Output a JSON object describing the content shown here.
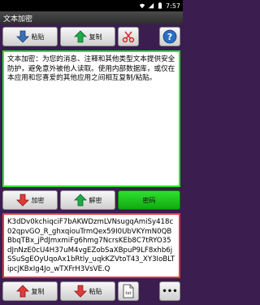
{
  "status": {
    "time": "7:57"
  },
  "app": {
    "title": "文本加密"
  },
  "top_toolbar": {
    "paste_label": "粘贴",
    "copy_label": "复制"
  },
  "plain_text": "文本加密：为您的消息、注释和其他类型文本提供安全防护，避免意外被他人读取。使用内部数据库，或仅在本应用和您喜爱的其他应用之间相互复制/粘贴。",
  "mid_toolbar": {
    "encrypt_label": "加密",
    "decrypt_label": "解密",
    "password_label": "密码"
  },
  "cipher_text": "K3dDv0kchiqciF7bAKWDzmLVNsugqAmiSy418c02qpvGO_R_ghxqiouTrmQex59I0UbVKYmN0QBBbqTBx_jPdJmxmiFg6hmg7NcrsKEb8C7tRYO35dJnNzE0cU4H37uM4vgEZobSaXBpuP9LF8xhb6jSSuSgEOyUqoAx1bRtly_uqkKZVtoT43_XY3IoBLTipcJKBxIg4Jo_wTXFrH3VsVE.Q",
  "bottom_toolbar": {
    "copy_label": "复制",
    "paste_label": "粘贴",
    "txt_label": "txt",
    "more_label": "•••"
  },
  "colors": {
    "background": "#3c1d4f",
    "plain_border": "#2ee62e",
    "cipher_border": "#e13b3b",
    "accent_green": "#1fc41f",
    "accent_red": "#e03a3a",
    "help_blue": "#2a6fc4"
  },
  "icons": {
    "paste": "down-arrow-icon",
    "copy": "up-arrow-icon",
    "clear": "scissors-icon",
    "help": "question-icon",
    "encrypt": "down-arrow-icon",
    "decrypt": "up-arrow-icon",
    "file": "document-icon",
    "more": "ellipsis-icon"
  }
}
